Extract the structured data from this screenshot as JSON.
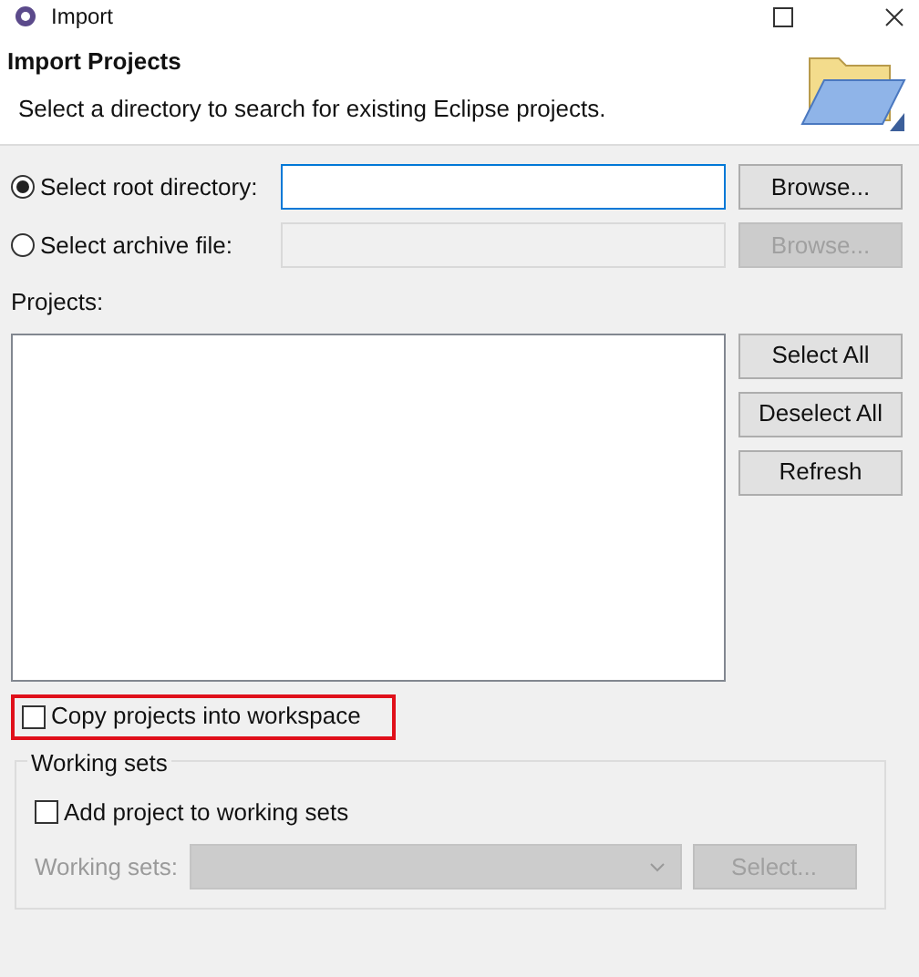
{
  "window": {
    "title": "Import"
  },
  "header": {
    "title": "Import Projects",
    "description": "Select a directory to search for existing Eclipse projects."
  },
  "sources": [
    {
      "label": "Select root directory:",
      "selected": true,
      "button": {
        "label": "Browse...",
        "disabled": false
      }
    },
    {
      "label": "Select archive file:",
      "selected": false,
      "button": {
        "label": "Browse...",
        "disabled": true
      }
    }
  ],
  "projects": {
    "label": "Projects:",
    "buttons": [
      {
        "label": "Select All"
      },
      {
        "label": "Deselect All"
      },
      {
        "label": "Refresh"
      }
    ]
  },
  "copy_option": {
    "label": "Copy projects into workspace",
    "checked": false,
    "highlighted": true
  },
  "working_sets": {
    "title": "Working sets",
    "add_option": {
      "label": "Add project to working sets",
      "checked": false
    },
    "field_label": "Working sets:",
    "disabled": true,
    "button": {
      "label": "Select..."
    }
  }
}
